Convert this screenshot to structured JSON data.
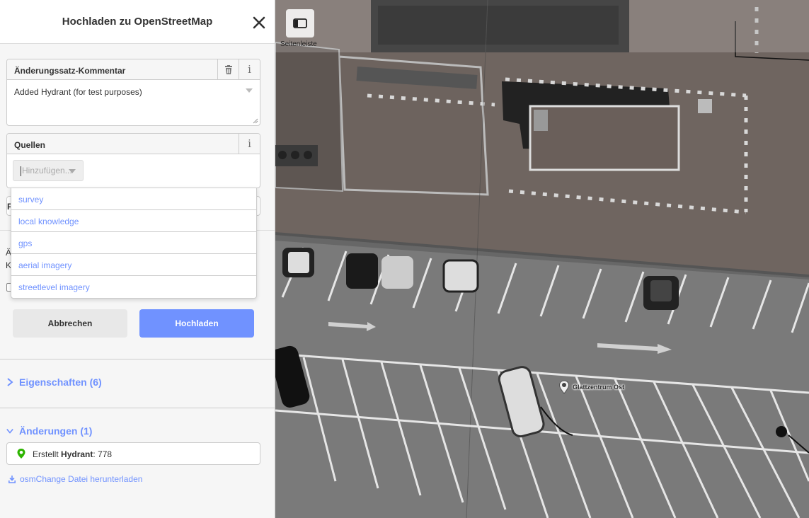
{
  "panel": {
    "title": "Hochladen zu OpenStreetMap"
  },
  "changeset_comment": {
    "label": "Änderungssatz-Kommentar",
    "value": "Added Hydrant (for test purposes)"
  },
  "sources": {
    "label": "Quellen",
    "placeholder": "Hinzufügen...",
    "options": [
      "survey",
      "local knowledge",
      "gps",
      "aerial imagery",
      "streetlevel imagery"
    ]
  },
  "hidden_behind_dropdown": {
    "field_label_partial": "F",
    "text_partial_1": "Ä",
    "text_partial_2": "K"
  },
  "buttons": {
    "cancel": "Abbrechen",
    "upload": "Hochladen"
  },
  "properties_section": {
    "label": "Eigenschaften (6)",
    "expanded": false
  },
  "changes_section": {
    "label": "Änderungen (1)",
    "expanded": true,
    "items": [
      {
        "action": "Erstellt",
        "type": "Hydrant",
        "suffix": ": 778",
        "icon": "map-pin-icon",
        "icon_color": "#2db400"
      }
    ]
  },
  "download_link": "osmChange Datei herunterladen",
  "map": {
    "sidebar_toggle_label": "Seitenleiste",
    "poi_label": "Glattzentrum Ost"
  },
  "colors": {
    "accent": "#7092ff",
    "pin": "#2db400"
  }
}
